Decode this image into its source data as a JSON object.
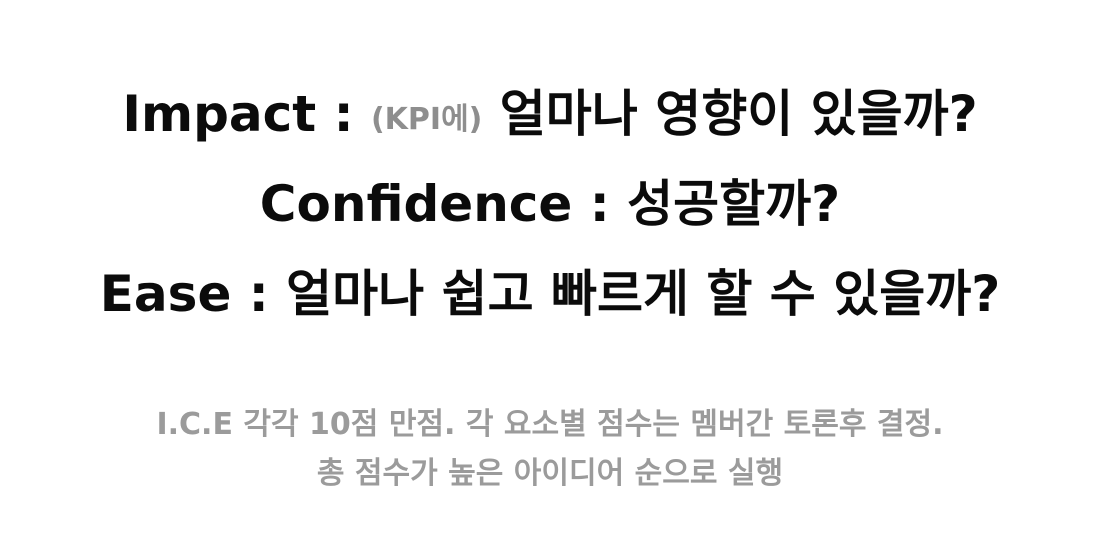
{
  "criteria": {
    "impact": {
      "term": "Impact",
      "sep": " : ",
      "note": "(KPI에)",
      "question": " 얼마나 영향이 있을까?"
    },
    "confidence": {
      "term": "Confidence",
      "sep": " : ",
      "question": "성공할까?"
    },
    "ease": {
      "term": "Ease",
      "sep": " : ",
      "question": "얼마나 쉽고 빠르게 할 수 있을까?"
    }
  },
  "notes": {
    "line1": "I.C.E 각각 10점 만점. 각 요소별 점수는 멤버간 토론후 결정.",
    "line2": "총 점수가 높은 아이디어 순으로 실행"
  },
  "colors": {
    "text": "#0b0b0b",
    "muted": "#9b9b9b",
    "background": "#ffffff"
  }
}
